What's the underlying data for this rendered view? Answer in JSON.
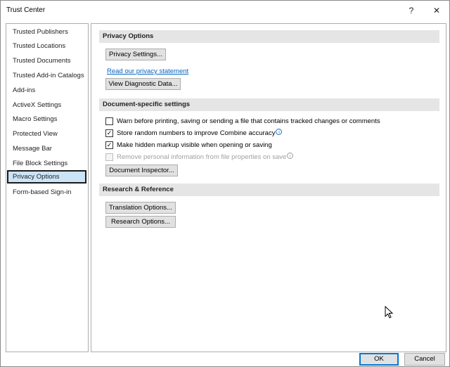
{
  "window": {
    "title": "Trust Center",
    "help": "?",
    "close": "✕"
  },
  "sidebar": {
    "items": [
      {
        "label": "Trusted Publishers"
      },
      {
        "label": "Trusted Locations"
      },
      {
        "label": "Trusted Documents"
      },
      {
        "label": "Trusted Add-in Catalogs"
      },
      {
        "label": "Add-ins"
      },
      {
        "label": "ActiveX Settings"
      },
      {
        "label": "Macro Settings"
      },
      {
        "label": "Protected View"
      },
      {
        "label": "Message Bar"
      },
      {
        "label": "File Block Settings"
      },
      {
        "label": "Privacy Options",
        "selected": true
      },
      {
        "label": "Form-based Sign-in"
      }
    ]
  },
  "privacy": {
    "heading": "Privacy Options",
    "settings_button": "Privacy Settings...",
    "statement_link": "Read our privacy statement",
    "diagnostic_button": "View Diagnostic Data..."
  },
  "document": {
    "heading": "Document-specific settings",
    "options": [
      {
        "label": "Warn before printing, saving or sending a file that contains tracked changes or comments",
        "checked": false,
        "disabled": false,
        "info": false
      },
      {
        "label": "Store random numbers to improve Combine accuracy",
        "checked": true,
        "disabled": false,
        "info": true
      },
      {
        "label": "Make hidden markup visible when opening or saving",
        "checked": true,
        "disabled": false,
        "info": false
      },
      {
        "label": "Remove personal information from file properties on save",
        "checked": false,
        "disabled": true,
        "info": true
      }
    ],
    "inspector_button": "Document Inspector..."
  },
  "research": {
    "heading": "Research & Reference",
    "translation_button": "Translation Options...",
    "research_button": "Research Options..."
  },
  "footer": {
    "ok": "OK",
    "cancel": "Cancel"
  },
  "icons": {
    "check": "✓",
    "info": "i"
  }
}
